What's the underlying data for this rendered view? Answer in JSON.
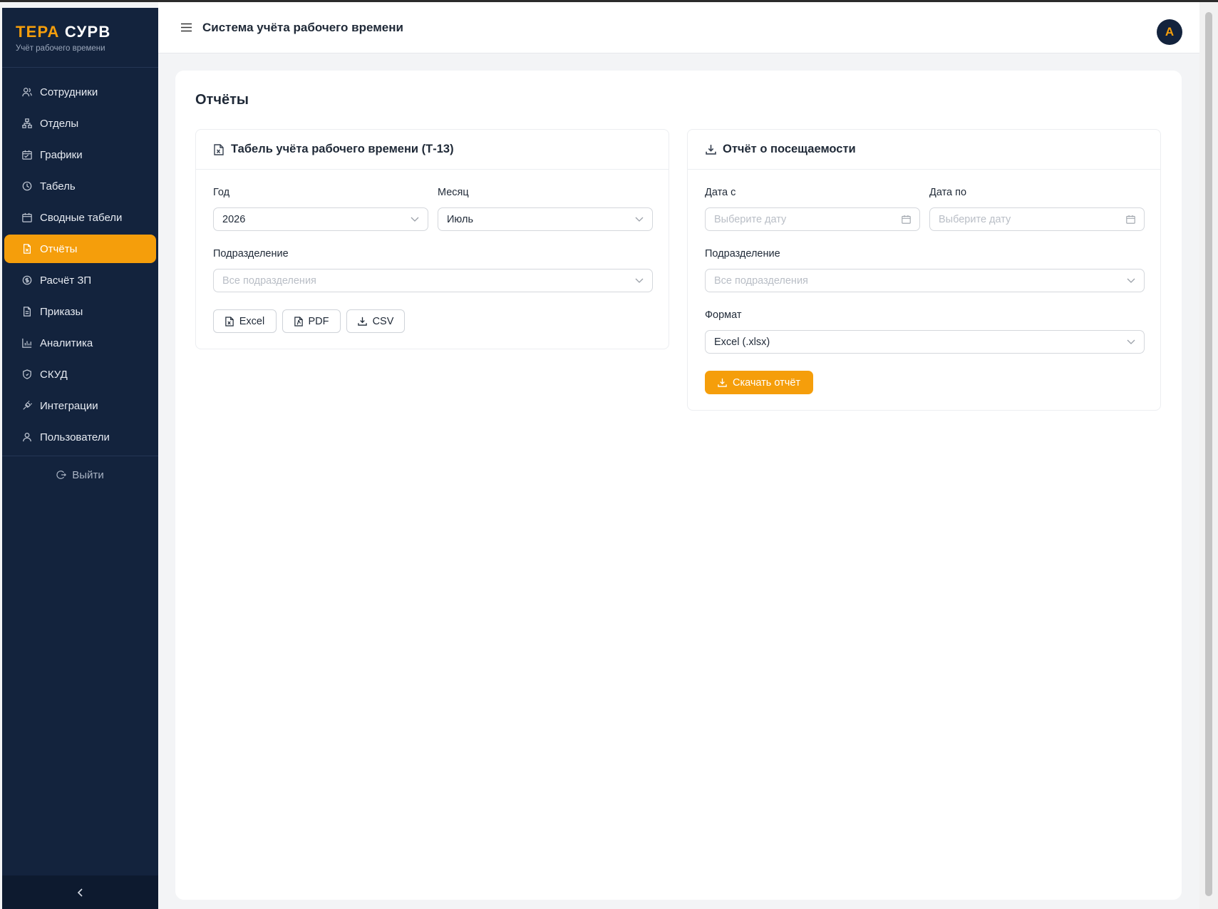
{
  "app": {
    "brand_part1": "ТЕРА",
    "brand_part2": "СУРВ",
    "brand_subtitle": "Учёт рабочего времени",
    "header_title": "Система учёта рабочего времени",
    "avatar_initial": "А",
    "accent_color": "#f59e0b",
    "sidebar_color": "#13233d"
  },
  "sidebar": {
    "items": [
      {
        "label": "Сотрудники",
        "icon": "users-icon"
      },
      {
        "label": "Отделы",
        "icon": "org-chart-icon"
      },
      {
        "label": "Графики",
        "icon": "calendar-schedule-icon"
      },
      {
        "label": "Табель",
        "icon": "clock-icon"
      },
      {
        "label": "Сводные табели",
        "icon": "calendar-icon"
      },
      {
        "label": "Отчёты",
        "icon": "report-file-icon",
        "active": true
      },
      {
        "label": "Расчёт ЗП",
        "icon": "dollar-circle-icon"
      },
      {
        "label": "Приказы",
        "icon": "document-icon"
      },
      {
        "label": "Аналитика",
        "icon": "bar-chart-icon"
      },
      {
        "label": "СКУД",
        "icon": "shield-icon"
      },
      {
        "label": "Интеграции",
        "icon": "plug-icon"
      },
      {
        "label": "Пользователи",
        "icon": "user-icon"
      }
    ],
    "logout_label": "Выйти"
  },
  "page": {
    "title": "Отчёты"
  },
  "timesheet_card": {
    "title": "Табель учёта рабочего времени (Т-13)",
    "year_label": "Год",
    "year_value": "2026",
    "month_label": "Месяц",
    "month_value": "Июль",
    "division_label": "Подразделение",
    "division_placeholder": "Все подразделения",
    "buttons": {
      "excel": "Excel",
      "pdf": "PDF",
      "csv": "CSV"
    }
  },
  "attendance_card": {
    "title": "Отчёт о посещаемости",
    "date_from_label": "Дата с",
    "date_from_placeholder": "Выберите дату",
    "date_to_label": "Дата по",
    "date_to_placeholder": "Выберите дату",
    "division_label": "Подразделение",
    "division_placeholder": "Все подразделения",
    "format_label": "Формат",
    "format_value": "Excel (.xlsx)",
    "download_label": "Скачать отчёт"
  }
}
